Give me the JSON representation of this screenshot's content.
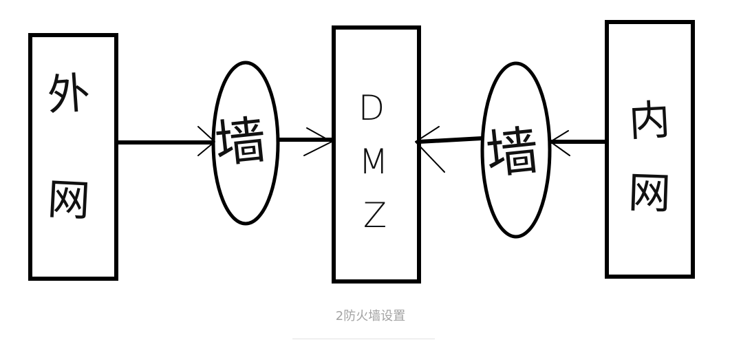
{
  "diagram": {
    "external_network": {
      "label_chars": [
        "外",
        "网"
      ]
    },
    "firewall_left": {
      "label": "墙"
    },
    "dmz": {
      "label_chars": [
        "D",
        "M",
        "Z"
      ]
    },
    "firewall_right": {
      "label": "墙"
    },
    "internal_network": {
      "label_chars": [
        "内",
        "网"
      ]
    }
  },
  "caption": {
    "text": "2防火墙设置"
  },
  "colors": {
    "stroke": "#000000",
    "caption": "#a3a3a3"
  }
}
